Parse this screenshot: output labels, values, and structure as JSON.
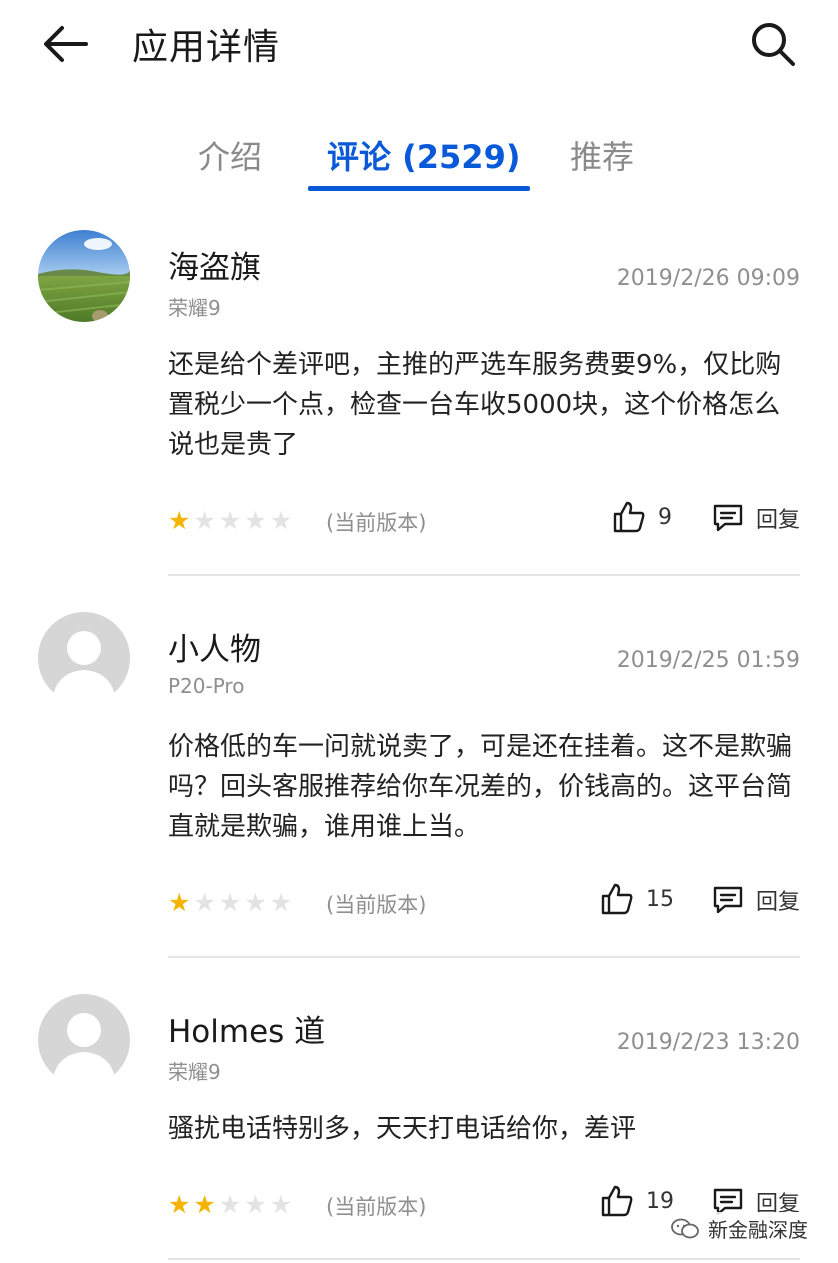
{
  "header": {
    "title": "应用详情",
    "back_icon": "back-arrow-icon",
    "search_icon": "search-icon"
  },
  "tabs": [
    {
      "label": "介绍",
      "active": false
    },
    {
      "label": "评论 (2529)",
      "active": true
    },
    {
      "label": "推荐",
      "active": false
    }
  ],
  "colors": {
    "accent": "#0a59d8",
    "star": "#f4b400",
    "star_empty": "#e3e3e3"
  },
  "reviews": [
    {
      "user": "海盗旗",
      "device": "荣耀9",
      "date": "2019/2/26 09:09",
      "text": "还是给个差评吧，主推的严选车服务费要9%，仅比购置税少一个点，检查一台车收5000块，这个价格怎么说也是贵了",
      "rating": 1,
      "version": "(当前版本)",
      "likes": "9",
      "reply_label": "回复",
      "avatar": "landscape"
    },
    {
      "user": "小人物",
      "device": "P20-Pro",
      "date": "2019/2/25 01:59",
      "text": "价格低的车一问就说卖了，可是还在挂着。这不是欺骗吗？回头客服推荐给你车况差的，价钱高的。这平台简直就是欺骗，谁用谁上当。",
      "rating": 1,
      "version": "(当前版本)",
      "likes": "15",
      "reply_label": "回复",
      "avatar": "default"
    },
    {
      "user": "Holmes 道",
      "device": "荣耀9",
      "date": "2019/2/23 13:20",
      "text": "骚扰电话特别多，天天打电话给你，差评",
      "rating": 2,
      "version": "(当前版本)",
      "likes": "19",
      "reply_label": "回复",
      "avatar": "default"
    }
  ],
  "watermark": {
    "text": "新金融深度"
  }
}
